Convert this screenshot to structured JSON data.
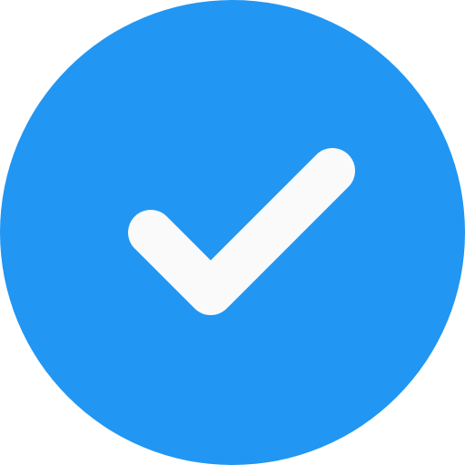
{
  "icon": {
    "name": "check-circle-icon",
    "circle_color": "#2196F3",
    "check_color": "#FAFAFA"
  }
}
